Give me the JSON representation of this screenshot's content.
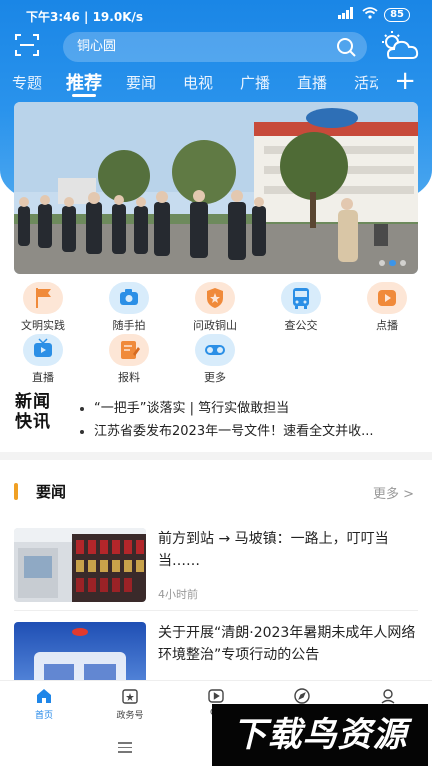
{
  "status_bar": {
    "time": "下午3:46 | 19.0K/s",
    "network": "4G",
    "battery": "85"
  },
  "search": {
    "placeholder": "铜心圆"
  },
  "tabs": [
    {
      "label": "专题"
    },
    {
      "label": "推荐"
    },
    {
      "label": "要闻"
    },
    {
      "label": "电视"
    },
    {
      "label": "广播"
    },
    {
      "label": "直播"
    },
    {
      "label": "活动"
    }
  ],
  "active_tab": "推荐",
  "banner": {
    "slide_count": 3,
    "active_slide": 1
  },
  "quick_links": [
    {
      "label": "文明实践",
      "icon": "flag-icon",
      "color": "orange"
    },
    {
      "label": "随手拍",
      "icon": "camera-icon",
      "color": "blue"
    },
    {
      "label": "问政铜山",
      "icon": "shield-star-icon",
      "color": "orange"
    },
    {
      "label": "查公交",
      "icon": "bus-icon",
      "color": "blue"
    },
    {
      "label": "点播",
      "icon": "play-icon",
      "color": "orange"
    },
    {
      "label": "直播",
      "icon": "tv-icon",
      "color": "blue"
    },
    {
      "label": "报料",
      "icon": "edit-icon",
      "color": "orange"
    },
    {
      "label": "更多",
      "icon": "toggle-icon",
      "color": "blue"
    }
  ],
  "news_flash": {
    "logo_line1": "新闻",
    "logo_line2": "快讯",
    "items": [
      "“一把手”谈落实 | 笃行实做敢担当",
      "江苏省委发布2023年一号文件！速看全文并收..."
    ]
  },
  "section": {
    "title": "要闻",
    "more": "更多 >"
  },
  "articles": [
    {
      "title": "前方到站 → 马坡镇：一路上，叮叮当当……",
      "time": "4小时前"
    },
    {
      "title": "关于开展“清朗·2023年暑期未成年人网络环境整治”专项行动的公告",
      "time": ""
    }
  ],
  "bottom_nav": [
    {
      "label": "首页",
      "icon": "home-icon",
      "active": true
    },
    {
      "label": "政务号",
      "icon": "gov-icon",
      "active": false
    },
    {
      "label": "Cu",
      "icon": "video-icon",
      "active": false
    },
    {
      "label": "",
      "icon": "compass-icon",
      "active": false
    },
    {
      "label": "",
      "icon": "user-icon",
      "active": false
    }
  ],
  "watermark": "下载鸟资源",
  "colors": {
    "brand_blue": "#1f86e8",
    "accent_orange": "#f0a024",
    "news_red": "#e23a2e"
  }
}
